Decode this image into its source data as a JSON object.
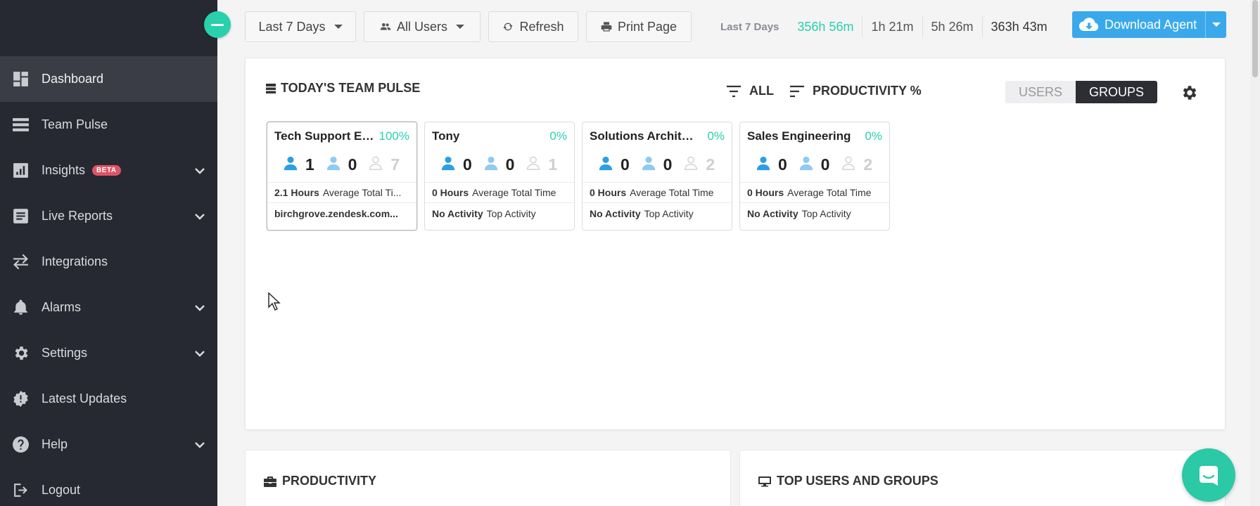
{
  "sidebar": {
    "items": [
      {
        "label": "Dashboard",
        "icon": "dashboard-icon"
      },
      {
        "label": "Team Pulse",
        "icon": "team-pulse-icon"
      },
      {
        "label": "Insights",
        "icon": "insights-icon",
        "badge": "BETA"
      },
      {
        "label": "Live Reports",
        "icon": "live-reports-icon"
      },
      {
        "label": "Integrations",
        "icon": "integrations-icon"
      },
      {
        "label": "Alarms",
        "icon": "bell-icon"
      },
      {
        "label": "Settings",
        "icon": "gear-icon"
      },
      {
        "label": "Latest Updates",
        "icon": "updates-icon"
      },
      {
        "label": "Help",
        "icon": "help-icon"
      },
      {
        "label": "Logout",
        "icon": "logout-icon"
      }
    ]
  },
  "toolbar": {
    "date_range": "Last 7 Days",
    "users_filter": "All Users",
    "refresh": "Refresh",
    "print": "Print Page",
    "download": "Download Agent"
  },
  "stats": {
    "period": "Last 7 Days",
    "productive": "356h 56m",
    "neutral": "1h 21m",
    "unproductive": "5h 26m",
    "total": "363h 43m"
  },
  "pulse": {
    "title": "TODAY'S TEAM PULSE",
    "filter_all": "ALL",
    "sort_label": "PRODUCTIVITY %",
    "toggle_users": "USERS",
    "toggle_groups": "GROUPS",
    "cards": [
      {
        "name": "Tech Support En...",
        "pct": "100%",
        "active": "1",
        "passive": "0",
        "offline": "7",
        "hours": "2.1 Hours",
        "hours_label": "Average Total Ti...",
        "activity": "birchgrove.zendesk.com...",
        "activity_label": ""
      },
      {
        "name": "Tony",
        "pct": "0%",
        "active": "0",
        "passive": "0",
        "offline": "1",
        "hours": "0 Hours",
        "hours_label": "Average Total Time",
        "activity": "No Activity",
        "activity_label": "Top Activity"
      },
      {
        "name": "Solutions Architect...",
        "pct": "0%",
        "active": "0",
        "passive": "0",
        "offline": "2",
        "hours": "0 Hours",
        "hours_label": "Average Total Time",
        "activity": "No Activity",
        "activity_label": "Top Activity"
      },
      {
        "name": "Sales Engineering",
        "pct": "0%",
        "active": "0",
        "passive": "0",
        "offline": "2",
        "hours": "0 Hours",
        "hours_label": "Average Total Time",
        "activity": "No Activity",
        "activity_label": "Top Activity"
      }
    ]
  },
  "panels": {
    "productivity": "PRODUCTIVITY",
    "top_users": "TOP USERS AND GROUPS"
  },
  "colors": {
    "accent": "#28d0ae",
    "primary": "#3aa9eb",
    "sidebar": "#262931"
  }
}
